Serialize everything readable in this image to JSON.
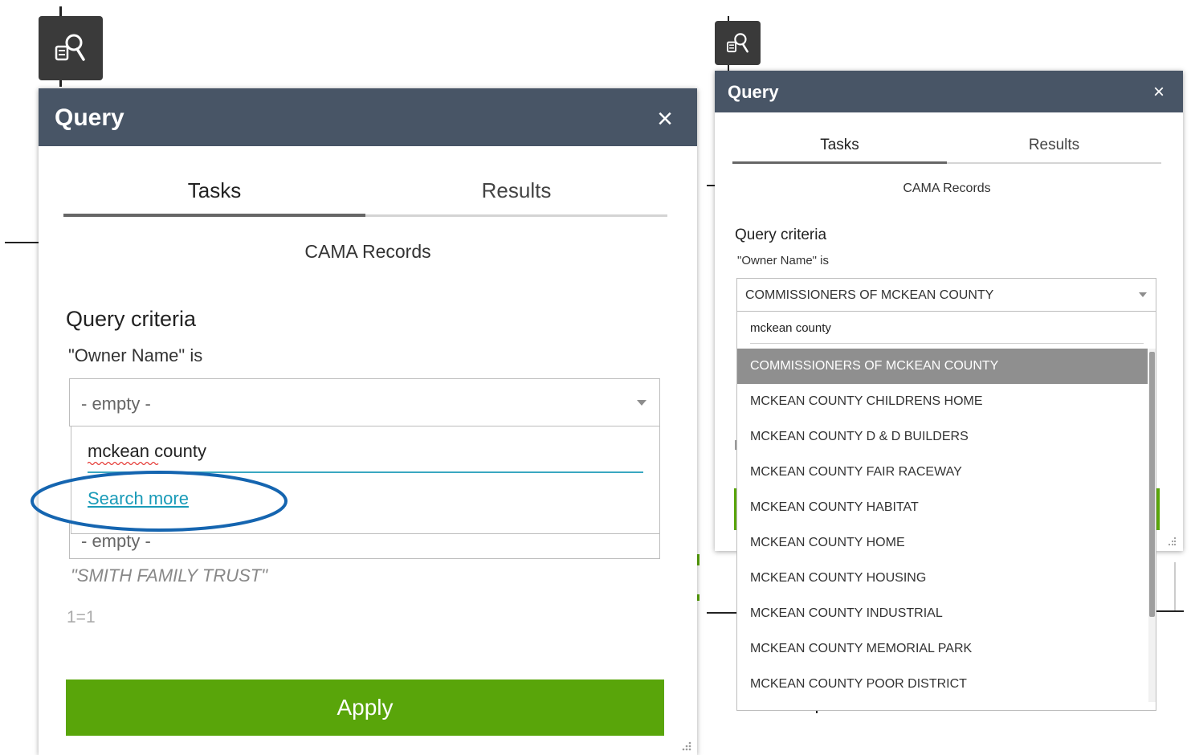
{
  "left_panel": {
    "title": "Query",
    "close_label": "×",
    "tabs": [
      {
        "label": "Tasks",
        "active": true
      },
      {
        "label": "Results",
        "active": false
      }
    ],
    "layer_name": "CAMA Records",
    "criteria_heading": "Query criteria",
    "field_label": "\"Owner Name\" is",
    "select_value": "- empty -",
    "search_text": "mckean county",
    "search_more": "Search more",
    "second_select_value": "- empty -",
    "hint_text": "\"SMITH FAMILY TRUST\"",
    "expression": "1=1",
    "apply_label": "Apply"
  },
  "right_panel": {
    "title": "Query",
    "close_label": "×",
    "tabs": [
      {
        "label": "Tasks",
        "active": true
      },
      {
        "label": "Results",
        "active": false
      }
    ],
    "layer_name": "CAMA Records",
    "criteria_heading": "Query criteria",
    "field_label": "\"Owner Name\" is",
    "select_value": "COMMISSIONERS OF MCKEAN COUNTY",
    "search_text": "mckean county",
    "options": [
      "COMMISSIONERS OF MCKEAN COUNTY",
      "MCKEAN COUNTY CHILDRENS HOME",
      "MCKEAN COUNTY D & D BUILDERS",
      "MCKEAN COUNTY FAIR RACEWAY",
      "MCKEAN COUNTY HABITAT",
      "MCKEAN COUNTY HOME",
      "MCKEAN COUNTY HOUSING",
      "MCKEAN COUNTY INDUSTRIAL",
      "MCKEAN COUNTY MEMORIAL PARK",
      "MCKEAN COUNTY POOR DISTRICT"
    ],
    "highlighted_option": "COMMISSIONERS OF MCKEAN COUNTY"
  },
  "colors": {
    "header": "#485566",
    "apply": "#59a50a",
    "highlight": "#8f8f8f",
    "link": "#1a9bb8",
    "annotation": "#1565b0"
  },
  "icons": [
    "query-widget-icon",
    "close-icon",
    "chevron-down-icon",
    "resize-handle-icon"
  ]
}
